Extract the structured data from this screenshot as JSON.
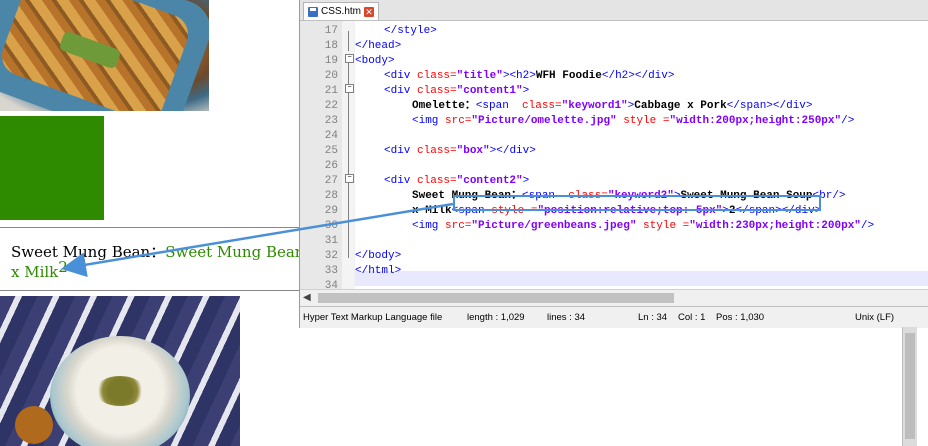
{
  "preview": {
    "line1_text": "Sweet Mung Bean：",
    "line1_keyword": "Sweet Mung Bean Soup",
    "line2_text": "x Milk",
    "line2_sup": "2"
  },
  "editor": {
    "tab_label": "CSS.htm",
    "lines": [
      {
        "n": "17"
      },
      {
        "n": "18"
      },
      {
        "n": "19"
      },
      {
        "n": "20"
      },
      {
        "n": "21"
      },
      {
        "n": "22"
      },
      {
        "n": "23"
      },
      {
        "n": "24"
      },
      {
        "n": "25"
      },
      {
        "n": "26"
      },
      {
        "n": "27"
      },
      {
        "n": "28"
      },
      {
        "n": "29"
      },
      {
        "n": "30"
      },
      {
        "n": "31"
      },
      {
        "n": "32"
      },
      {
        "n": "33"
      },
      {
        "n": "34"
      }
    ],
    "code": {
      "l17_tag": "</style>",
      "l18_tag": "</head>",
      "l19_tag": "<body>",
      "l20_a": "<div ",
      "l20_attr": "class=",
      "l20_val": "\"title\"",
      "l20_b": "><h2>",
      "l20_text": "WFH Foodie",
      "l20_c": "</h2></div>",
      "l21_a": "<div ",
      "l21_attr": "class=",
      "l21_val": "\"content1\"",
      "l21_b": ">",
      "l22_text": "Omelette：",
      "l22_a": "<span  ",
      "l22_attr": "class=",
      "l22_val": "\"keyword1\"",
      "l22_b": ">",
      "l22_text2": "Cabbage x Pork",
      "l22_c": "</span></div>",
      "l23_a": "<img ",
      "l23_attr1": "src=",
      "l23_val1": "\"Picture/omelette.jpg\"",
      "l23_attr2": " style =",
      "l23_val2": "\"width:200px;height:250px\"",
      "l23_b": "/>",
      "l25_a": "<div ",
      "l25_attr": "class=",
      "l25_val": "\"box\"",
      "l25_b": "></div>",
      "l27_a": "<div ",
      "l27_attr": "class=",
      "l27_val": "\"content2\"",
      "l27_b": ">",
      "l28_text": "Sweet Mung Bean：",
      "l28_a": "<span  ",
      "l28_attr": "class=",
      "l28_val": "\"keyword2\"",
      "l28_b": ">",
      "l28_text2": "Sweet Mung Bean Soup",
      "l28_c": "<br/>",
      "l29_text": "x Milk",
      "l29_a": "<span ",
      "l29_attr": "style =",
      "l29_val": "\"position:relative;top:-5px\"",
      "l29_b": ">",
      "l29_text2": "2",
      "l29_c": "</span></div>",
      "l30_a": "<img ",
      "l30_attr1": "src=",
      "l30_val1": "\"Picture/greenbeans.jpeg\"",
      "l30_attr2": " style =",
      "l30_val2": "\"width:230px;height:200px\"",
      "l30_b": "/>",
      "l32_tag": "</body>",
      "l33_tag": "</html>"
    },
    "status": {
      "file_type": "Hyper Text Markup Language file",
      "length": "length : 1,029",
      "lines": "lines : 34",
      "ln": "Ln : 34",
      "col": "Col : 1",
      "pos": "Pos : 1,030",
      "eol": "Unix (LF)"
    }
  },
  "colors": {
    "tag": "#0000ff",
    "attr": "#ff0000",
    "value": "#8000ff",
    "keyword_green": "#2e8b00",
    "annotation_blue": "#4a90d9"
  }
}
